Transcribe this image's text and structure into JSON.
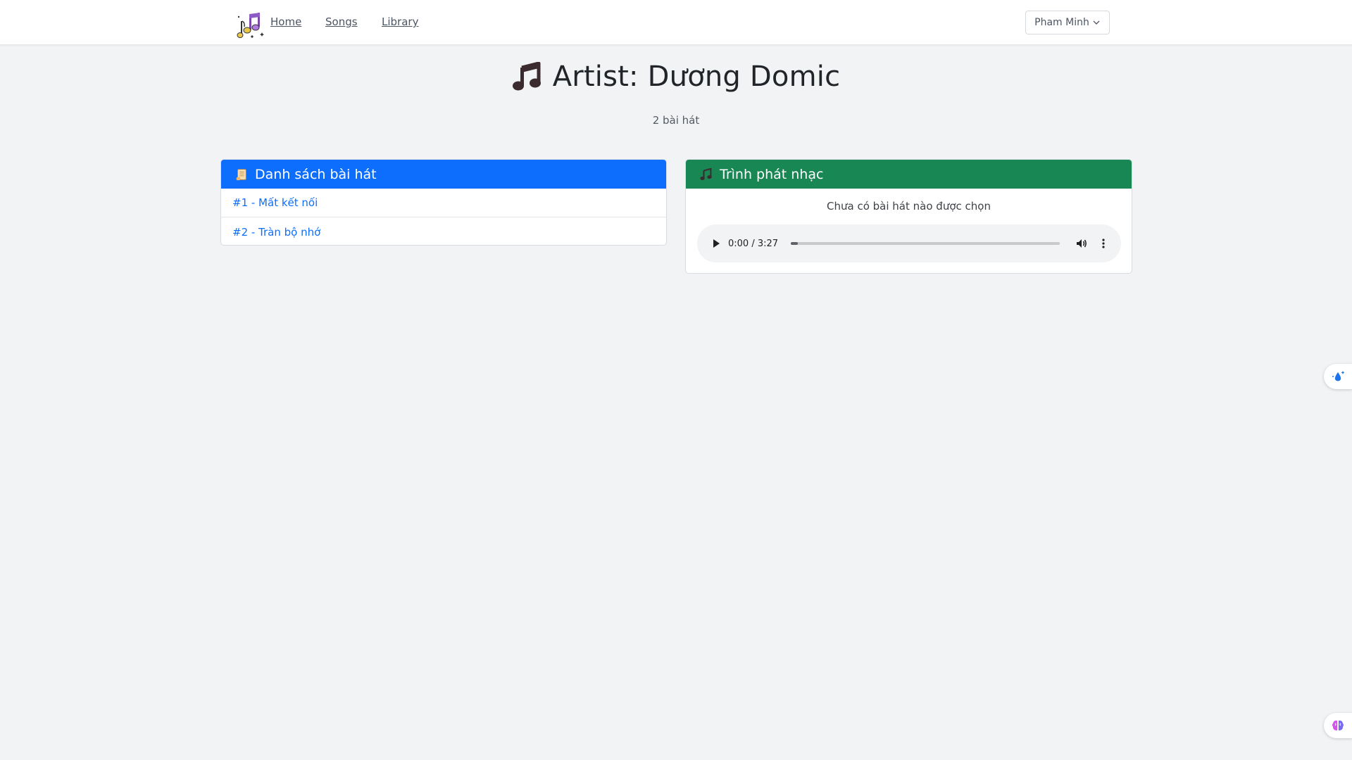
{
  "navbar": {
    "logo_icon": "music-notes-logo-icon",
    "links": {
      "home": "Home",
      "songs": "Songs",
      "library": "Library"
    },
    "user": {
      "name": "Pham Minh",
      "dropdown_icon": "chevron-down-icon"
    }
  },
  "page": {
    "title": "Artist: Dương Domic",
    "title_icon": "music-note-icon",
    "song_count": "2 bài hát"
  },
  "song_list": {
    "header": "Danh sách bài hát",
    "header_icon": "scroll-icon",
    "accent_color": "#0d6efd",
    "items": [
      {
        "label": "#1 - Mất kết nối"
      },
      {
        "label": "#2 - Tràn bộ nhớ"
      }
    ]
  },
  "player": {
    "header": "Trình phát nhạc",
    "header_icon": "music-notes-icon",
    "accent_color": "#198754",
    "status": "Chưa có bài hát nào được chọn",
    "audio": {
      "time": "0:00 / 3:27",
      "progress": 0.0
    }
  },
  "widgets": {
    "top_icon": "water-drop-sparkle-icon",
    "bottom_icon": "brain-icon"
  }
}
